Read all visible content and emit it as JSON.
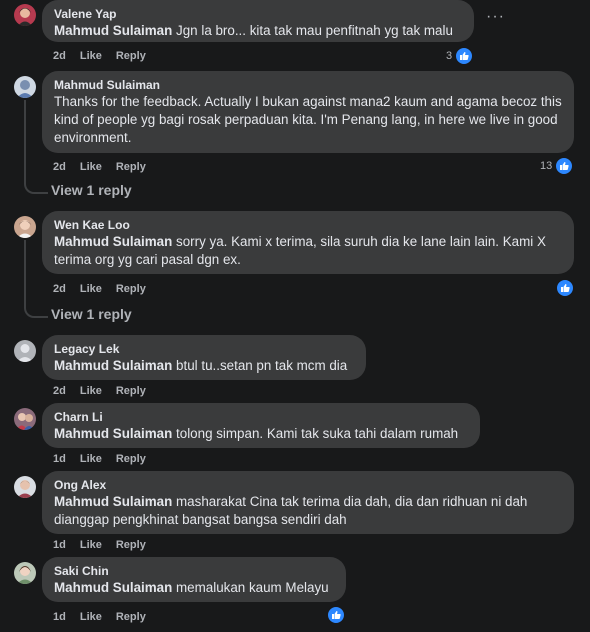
{
  "comments": [
    {
      "author": "Valene Yap",
      "mention": "Mahmud Sulaiman",
      "text": " Jgn la bro... kita tak mau penfitnah yg tak malu",
      "time": "2d",
      "like": "Like",
      "reply": "Reply",
      "reactions": "3"
    },
    {
      "author": "Mahmud Sulaiman",
      "mention": "",
      "text": "Thanks for the feedback. Actually I bukan against mana2 kaum and agama becoz this kind of people yg bagi rosak perpaduan kita. I'm Penang lang, in here we live in good environment.",
      "time": "2d",
      "like": "Like",
      "reply": "Reply",
      "reactions": "13",
      "view_reply": "View 1 reply"
    },
    {
      "author": "Wen Kae Loo",
      "mention": "Mahmud Sulaiman",
      "text": " sorry ya. Kami x terima, sila suruh dia ke lane lain lain. Kami X terima org yg cari pasal dgn ex.",
      "time": "2d",
      "like": "Like",
      "reply": "Reply",
      "reactions": "",
      "view_reply": "View 1 reply"
    },
    {
      "author": "Legacy Lek",
      "mention": "Mahmud Sulaiman",
      "text": " btul tu..setan pn tak mcm dia",
      "time": "2d",
      "like": "Like",
      "reply": "Reply"
    },
    {
      "author": "Charn Li",
      "mention": "Mahmud Sulaiman",
      "text": " tolong simpan. Kami tak suka tahi dalam rumah",
      "time": "1d",
      "like": "Like",
      "reply": "Reply"
    },
    {
      "author": "Ong Alex",
      "mention": "Mahmud Sulaiman",
      "text": " masharakat Cina tak terima dia dah, dia dan ridhuan ni dah dianggap pengkhinat bangsat bangsa sendiri dah",
      "time": "1d",
      "like": "Like",
      "reply": "Reply"
    },
    {
      "author": "Saki Chin",
      "mention": "Mahmud Sulaiman",
      "text": " memalukan kaum Melayu",
      "time": "1d",
      "like": "Like",
      "reply": "Reply"
    }
  ],
  "colors": {
    "bg": "#18191a",
    "bubble": "#3a3b3c",
    "like_blue": "#2d88ff",
    "muted": "#b0b3b8"
  },
  "icons": {
    "more": "more-dots-icon",
    "like": "thumbs-up-icon"
  }
}
